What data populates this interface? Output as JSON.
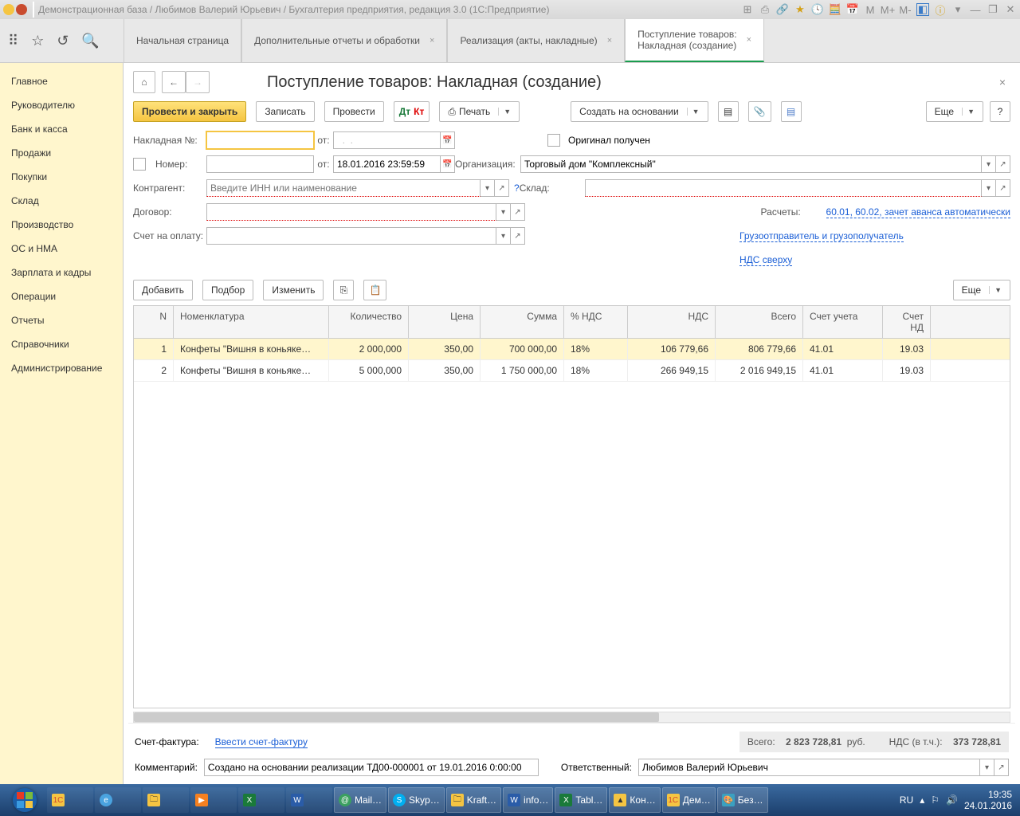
{
  "titlebar": {
    "path": "Демонстрационная база / Любимов Валерий Юрьевич / Бухгалтерия предприятия, редакция 3.0  (1С:Предприятие)"
  },
  "tabs": {
    "t0": "Начальная страница",
    "t1": "Дополнительные отчеты и обработки",
    "t2": "Реализация (акты, накладные)",
    "t3_l1": "Поступление товаров:",
    "t3_l2": "Накладная (создание)"
  },
  "sidebar": {
    "i0": "Главное",
    "i1": "Руководителю",
    "i2": "Банк и касса",
    "i3": "Продажи",
    "i4": "Покупки",
    "i5": "Склад",
    "i6": "Производство",
    "i7": "ОС и НМА",
    "i8": "Зарплата и кадры",
    "i9": "Операции",
    "i10": "Отчеты",
    "i11": "Справочники",
    "i12": "Администрирование"
  },
  "page": {
    "title": "Поступление товаров: Накладная (создание)",
    "post_close": "Провести и закрыть",
    "save": "Записать",
    "post": "Провести",
    "print": "Печать",
    "create_based": "Создать на основании",
    "more": "Еще",
    "help": "?"
  },
  "form": {
    "invoice_no": "Накладная №:",
    "from": "от:",
    "number": "Номер:",
    "date_value": "18.01.2016 23:59:59",
    "original_received": "Оригинал получен",
    "organization": "Организация:",
    "organization_value": "Торговый дом \"Комплексный\"",
    "contractor": "Контрагент:",
    "contractor_placeholder": "Введите ИНН или наименование",
    "warehouse": "Склад:",
    "contract": "Договор:",
    "calculations": "Расчеты:",
    "calc_link": "60.01, 60.02, зачет аванса автоматически",
    "shipper_link": "Грузоотправитель и грузополучатель",
    "vat_link": "НДС сверху",
    "invoice_account": "Счет на оплату:"
  },
  "table": {
    "add": "Добавить",
    "pick": "Подбор",
    "edit": "Изменить",
    "more": "Еще",
    "h_n": "N",
    "h_name": "Номенклатура",
    "h_qty": "Количество",
    "h_price": "Цена",
    "h_sum": "Сумма",
    "h_vatp": "% НДС",
    "h_vat": "НДС",
    "h_total": "Всего",
    "h_acc": "Счет учета",
    "h_acc2": "Счет НД",
    "rows": [
      {
        "n": "1",
        "name": "Конфеты \"Вишня в коньяке…",
        "qty": "2 000,000",
        "price": "350,00",
        "sum": "700 000,00",
        "vatp": "18%",
        "vat": "106 779,66",
        "total": "806 779,66",
        "acc": "41.01",
        "acc2": "19.03"
      },
      {
        "n": "2",
        "name": "Конфеты \"Вишня в коньяке…",
        "qty": "5 000,000",
        "price": "350,00",
        "sum": "1 750 000,00",
        "vatp": "18%",
        "vat": "266 949,15",
        "total": "2 016 949,15",
        "acc": "41.01",
        "acc2": "19.03"
      }
    ]
  },
  "footer": {
    "sf": "Счет-фактура:",
    "sf_link": "Ввести счет-фактуру",
    "total_lbl": "Всего:",
    "total_val": "2 823 728,81",
    "currency": "руб.",
    "vat_lbl": "НДС (в т.ч.):",
    "vat_val": "373 728,81",
    "comment": "Комментарий:",
    "comment_val": "Создано на основании реализации ТД00-000001 от 19.01.2016 0:00:00",
    "responsible": "Ответственный:",
    "responsible_val": "Любимов Валерий Юрьевич"
  },
  "taskbar": {
    "apps": [
      "Mail…",
      "Skyp…",
      "Kraft…",
      "info…",
      "Tabl…",
      "Кон…",
      "Дем…",
      "Без…"
    ],
    "lang": "RU",
    "time": "19:35",
    "date": "24.01.2016"
  }
}
